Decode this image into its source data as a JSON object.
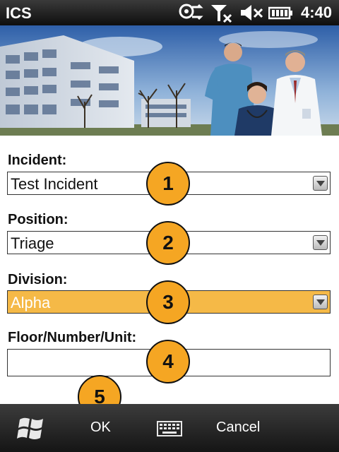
{
  "status_bar": {
    "app_title": "ICS",
    "time": "4:40",
    "icons": [
      "data-sync-icon",
      "no-signal-icon",
      "volume-muted-icon",
      "battery-icon"
    ]
  },
  "banner": {
    "description_icon": "hospital-staff-photo"
  },
  "form": {
    "incident": {
      "label": "Incident:",
      "value": "Test Incident"
    },
    "position": {
      "label": "Position:",
      "value": "Triage"
    },
    "division": {
      "label": "Division:",
      "value": "Alpha"
    },
    "floor": {
      "label": "Floor/Number/Unit:",
      "value": ""
    }
  },
  "callouts": [
    "1",
    "2",
    "3",
    "4",
    "5"
  ],
  "softkey_bar": {
    "start_icon": "windows-start-icon",
    "left_label": "OK",
    "keyboard_icon": "keyboard-icon",
    "right_label": "Cancel"
  },
  "colors": {
    "highlight": "#f5b947",
    "callout": "#f5a623"
  }
}
